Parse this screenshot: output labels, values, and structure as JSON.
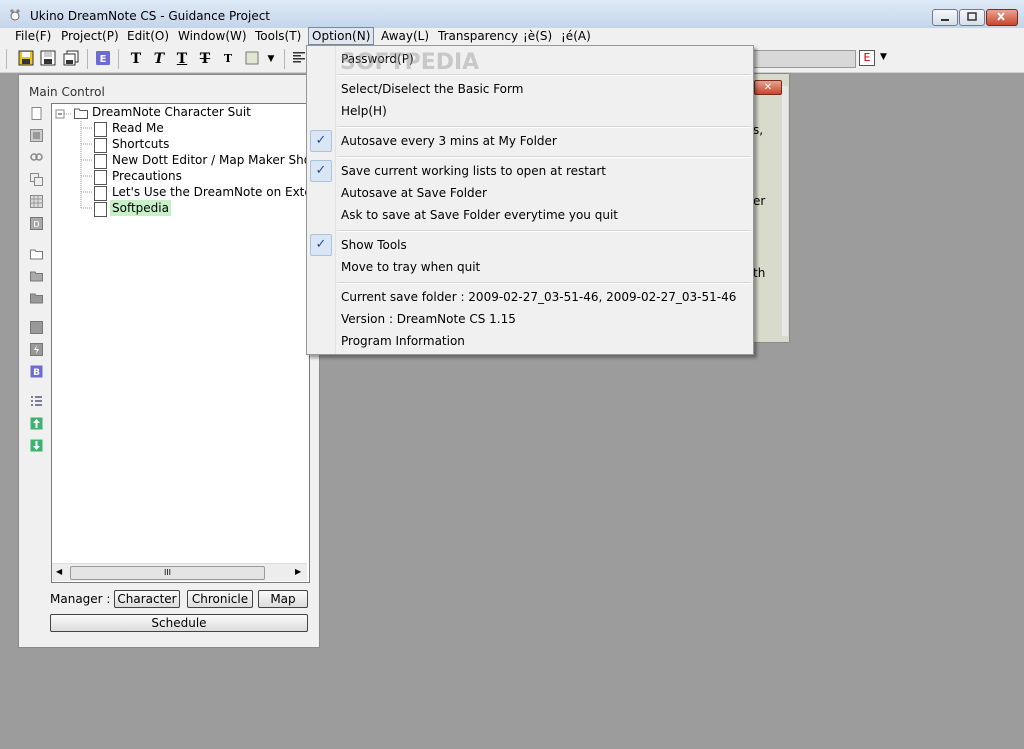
{
  "window": {
    "title": "Ukino DreamNote CS - Guidance Project"
  },
  "menubar": {
    "items": [
      "File(F)",
      "Project(P)",
      "Edit(O)",
      "Window(W)",
      "Tools(T)",
      "Option(N)",
      "Away(L)",
      "Transparency",
      "¡è(S)",
      "¡é(A)"
    ]
  },
  "toolbar": {
    "text_btns": [
      "T",
      "T",
      "T",
      "T",
      "T"
    ],
    "e_label": "E"
  },
  "main_control": {
    "title": "Main Control",
    "tree": {
      "root": "DreamNote Character Suit",
      "children": [
        "Read Me",
        "Shortcuts",
        "New Dott Editor / Map Maker Shortcuts",
        "Precautions",
        "Let's Use the DreamNote on Exterior Computer",
        "Softpedia"
      ],
      "selected_index": 5
    },
    "scroll_grip": "III",
    "manager_label": "Manager :",
    "buttons": {
      "character": "Character",
      "chronicle": "Chronicle",
      "map": "Map",
      "schedule": "Schedule"
    }
  },
  "option_menu": {
    "items": [
      {
        "label": "Password(P)",
        "checked": false
      },
      {
        "label": "Select/Diselect the Basic Form",
        "checked": false
      },
      {
        "label": "Help(H)",
        "checked": false
      },
      {
        "label": "Autosave every 3 mins at My Folder",
        "checked": true
      },
      {
        "label": "Save current working lists to open at restart",
        "checked": true
      },
      {
        "label": "Autosave at Save Folder",
        "checked": false
      },
      {
        "label": "Ask to save at Save Folder everytime you quit",
        "checked": false
      },
      {
        "label": "Show Tools",
        "checked": true
      },
      {
        "label": "Move to tray when quit",
        "checked": false
      },
      {
        "label": "Current save folder : 2009-02-27_03-51-46,   2009-02-27_03-51-46",
        "checked": false
      },
      {
        "label": "Version : DreamNote CS 1.15",
        "checked": false
      },
      {
        "label": "Program Information",
        "checked": false
      }
    ],
    "check_glyph": "✓"
  },
  "background_window": {
    "fragments": [
      "s,",
      "er",
      "th"
    ]
  },
  "watermark": "SOFTPEDIA",
  "colors": {
    "selected_tree_bg": "#c8f0c8",
    "menu_highlight": "#dbe6f4"
  }
}
